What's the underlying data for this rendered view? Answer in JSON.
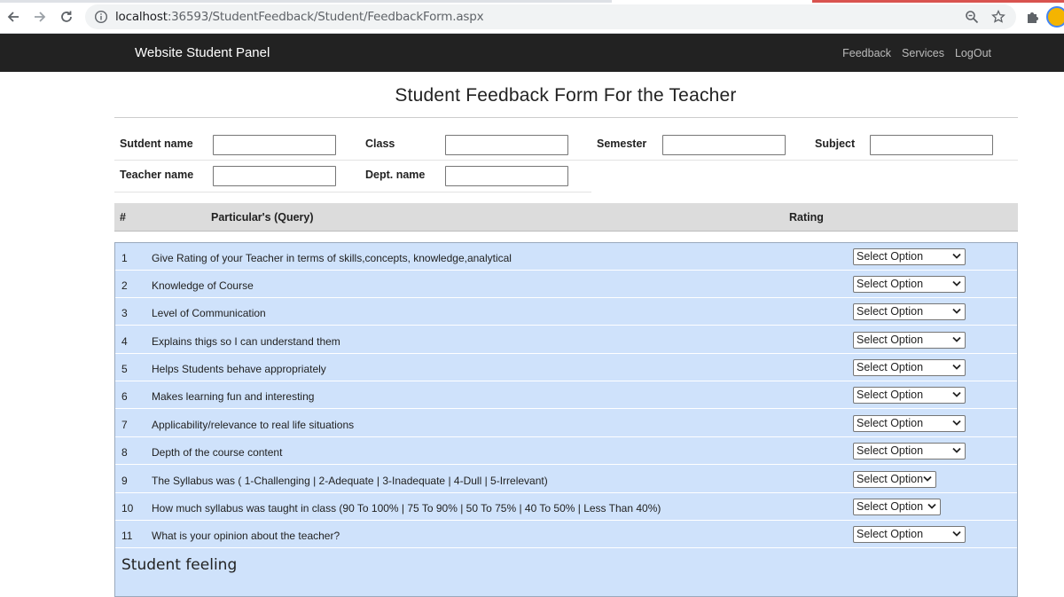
{
  "browser": {
    "url_host": "localhost",
    "url_path": ":36593/StudentFeedback/Student/FeedbackForm.aspx"
  },
  "navbar": {
    "brand": "Website Student Panel",
    "links": [
      "Feedback",
      "Services",
      "LogOut"
    ]
  },
  "page": {
    "title": "Student Feedback Form For the Teacher"
  },
  "form": {
    "student_name_label": "Sutdent name",
    "student_name_value": "",
    "class_label": "Class",
    "class_value": "",
    "semester_label": "Semester",
    "semester_value": "",
    "subject_label": "Subject",
    "subject_value": "",
    "teacher_name_label": "Teacher name",
    "teacher_name_value": "",
    "dept_name_label": "Dept. name",
    "dept_name_value": ""
  },
  "table": {
    "headers": [
      "#",
      "Particular's (Query)",
      "Rating"
    ],
    "rows": [
      {
        "num": "1",
        "query": "Give Rating of your Teacher in terms of skills,concepts, knowledge,analytical",
        "rating": "Select Option"
      },
      {
        "num": "2",
        "query": "Knowledge of Course",
        "rating": "Select Option"
      },
      {
        "num": "3",
        "query": "Level of Communication",
        "rating": "Select Option"
      },
      {
        "num": "4",
        "query": "Explains thigs so I can understand them",
        "rating": "Select Option"
      },
      {
        "num": "5",
        "query": "Helps Students behave appropriately",
        "rating": "Select Option"
      },
      {
        "num": "6",
        "query": "Makes learning fun and interesting",
        "rating": "Select Option"
      },
      {
        "num": "7",
        "query": "Applicability/relevance to real life situations",
        "rating": "Select Option"
      },
      {
        "num": "8",
        "query": "Depth of the course content",
        "rating": "Select Option"
      },
      {
        "num": "9",
        "query": "The Syllabus was ( 1-Challenging | 2-Adequate | 3-Inadequate | 4-Dull | 5-Irrelevant)",
        "rating": "Select Option"
      },
      {
        "num": "10",
        "query": "How much syllabus was taught in class (90 To 100% | 75 To 90% | 50 To 75% | 40 To 50% | Less Than 40%)",
        "rating": "Select Option"
      },
      {
        "num": "11",
        "query": "What is your opinion about the teacher?",
        "rating": "Select Option"
      }
    ],
    "section_heading": "Student feeling"
  }
}
